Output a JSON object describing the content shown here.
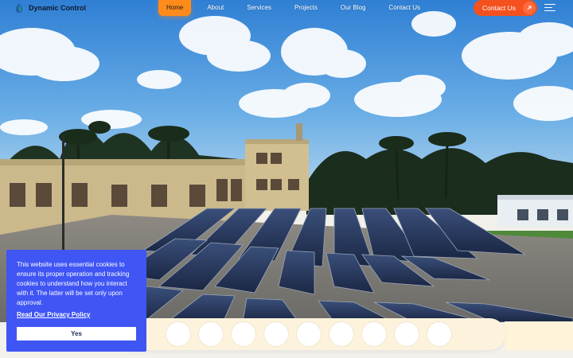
{
  "brand": {
    "name": "Dynamic Control",
    "icon": "leaf-drop-logo-icon",
    "colors": {
      "mark_green": "#2e9e5b",
      "mark_blue": "#1f5fb8"
    }
  },
  "nav": {
    "items": [
      {
        "label": "Home",
        "active": true
      },
      {
        "label": "About",
        "active": false
      },
      {
        "label": "Services",
        "active": false
      },
      {
        "label": "Projects",
        "active": false
      },
      {
        "label": "Our Blog",
        "active": false
      },
      {
        "label": "Contact Us",
        "active": false
      }
    ],
    "active_color": "#ff8c1a"
  },
  "header_actions": {
    "contact_label": "Contact Us",
    "contact_icon": "arrow-up-right-icon",
    "contact_color": "#f4511e",
    "menu_icon": "hamburger-menu-icon"
  },
  "cookie_banner": {
    "message": "This website uses essential cookies to ensure its proper operation and tracking cookies to understand how you interact with it. The latter will be set only upon approval.",
    "privacy_link": "Read Our Privacy Policy",
    "accept_label": "Yes",
    "background": "#3f55f4"
  },
  "carousel": {
    "placeholder_count": 9,
    "bar_color": "#fdf3dc"
  }
}
